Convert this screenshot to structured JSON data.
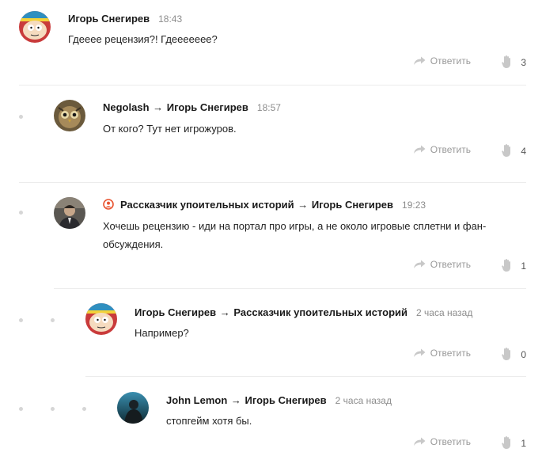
{
  "reply_label": "Ответить",
  "accent_color": "#e8532f",
  "comments": [
    {
      "author": "Игорь Снегирев",
      "arrow": "",
      "target": "",
      "time": "18:43",
      "text": "Гдееее рецензия?! Гдеееееее?",
      "likes": "3",
      "avatar": "cartman-avatar"
    },
    {
      "author": "Negolash",
      "arrow": "→",
      "target": "Игорь Снегирев",
      "time": "18:57",
      "text": "От кого? Тут нет игрожуров.",
      "likes": "4",
      "avatar": "owl-avatar"
    },
    {
      "author": "Рассказчик упоительных историй",
      "arrow": "→",
      "target": "Игорь Снегирев",
      "time": "19:23",
      "text": "Хочешь рецензию - иди на портал про игры, а не около игровые сплетни и фан-обсуждения.",
      "likes": "1",
      "avatar": "man-avatar",
      "source_icon": "circle-person-icon"
    },
    {
      "author": "Игорь Снегирев",
      "arrow": "→",
      "target": "Рассказчик упоительных историй",
      "time": "2 часа назад",
      "text": "Например?",
      "likes": "0",
      "avatar": "cartman-avatar"
    },
    {
      "author": "John Lemon",
      "arrow": "→",
      "target": "Игорь Снегирев",
      "time": "2 часа назад",
      "text": "стопгейм хотя бы.",
      "likes": "1",
      "avatar": "figure-avatar"
    }
  ]
}
